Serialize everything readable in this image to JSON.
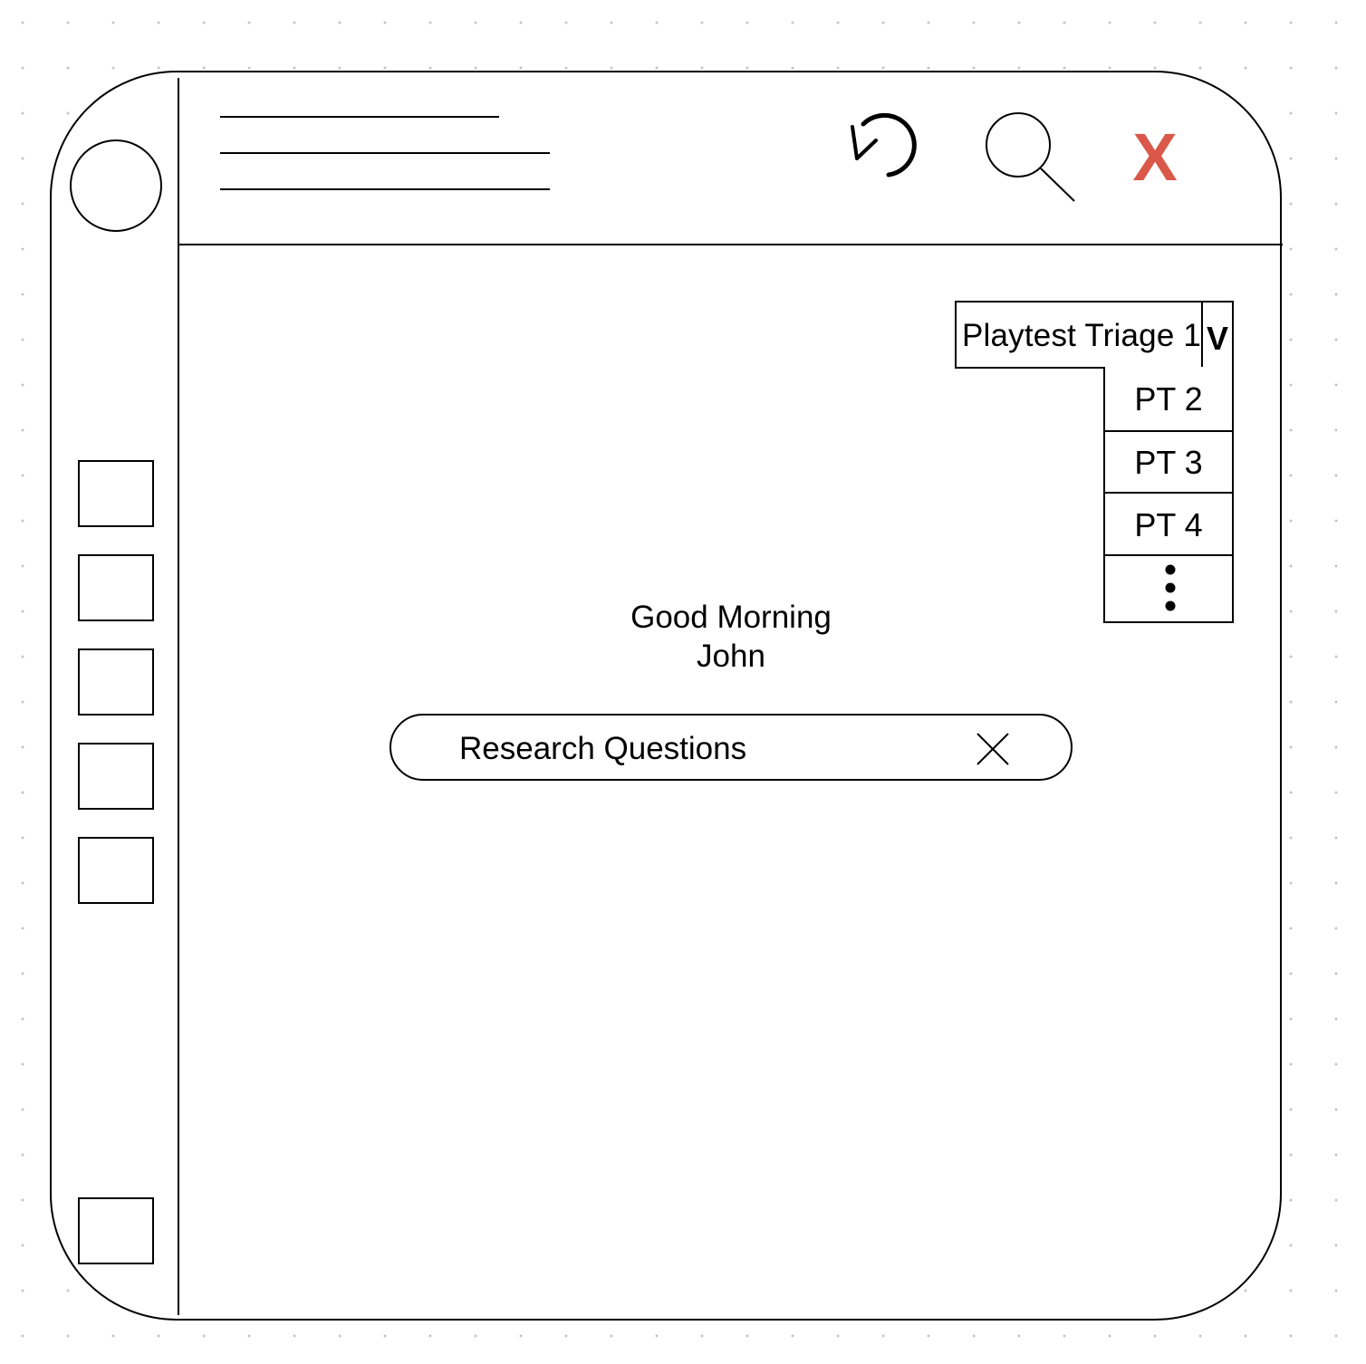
{
  "header": {
    "icons": [
      "refresh-icon",
      "search-icon",
      "close-window-icon"
    ],
    "close_label": "X",
    "close_color": "#d9584a"
  },
  "sidebar": {
    "items": [
      "nav-item-1",
      "nav-item-2",
      "nav-item-3",
      "nav-item-4",
      "nav-item-5"
    ],
    "bottom_item": "nav-item-bottom"
  },
  "project_select": {
    "selected": "Playtest Triage 1",
    "toggle_label": "V",
    "options": [
      "PT 2",
      "PT 3",
      "PT 4"
    ],
    "more_icon": "more-vertical-icon"
  },
  "main": {
    "greeting_line1": "Good Morning",
    "greeting_line2": "John"
  },
  "search": {
    "value": "Research Questions",
    "clear_icon": "close-icon"
  }
}
